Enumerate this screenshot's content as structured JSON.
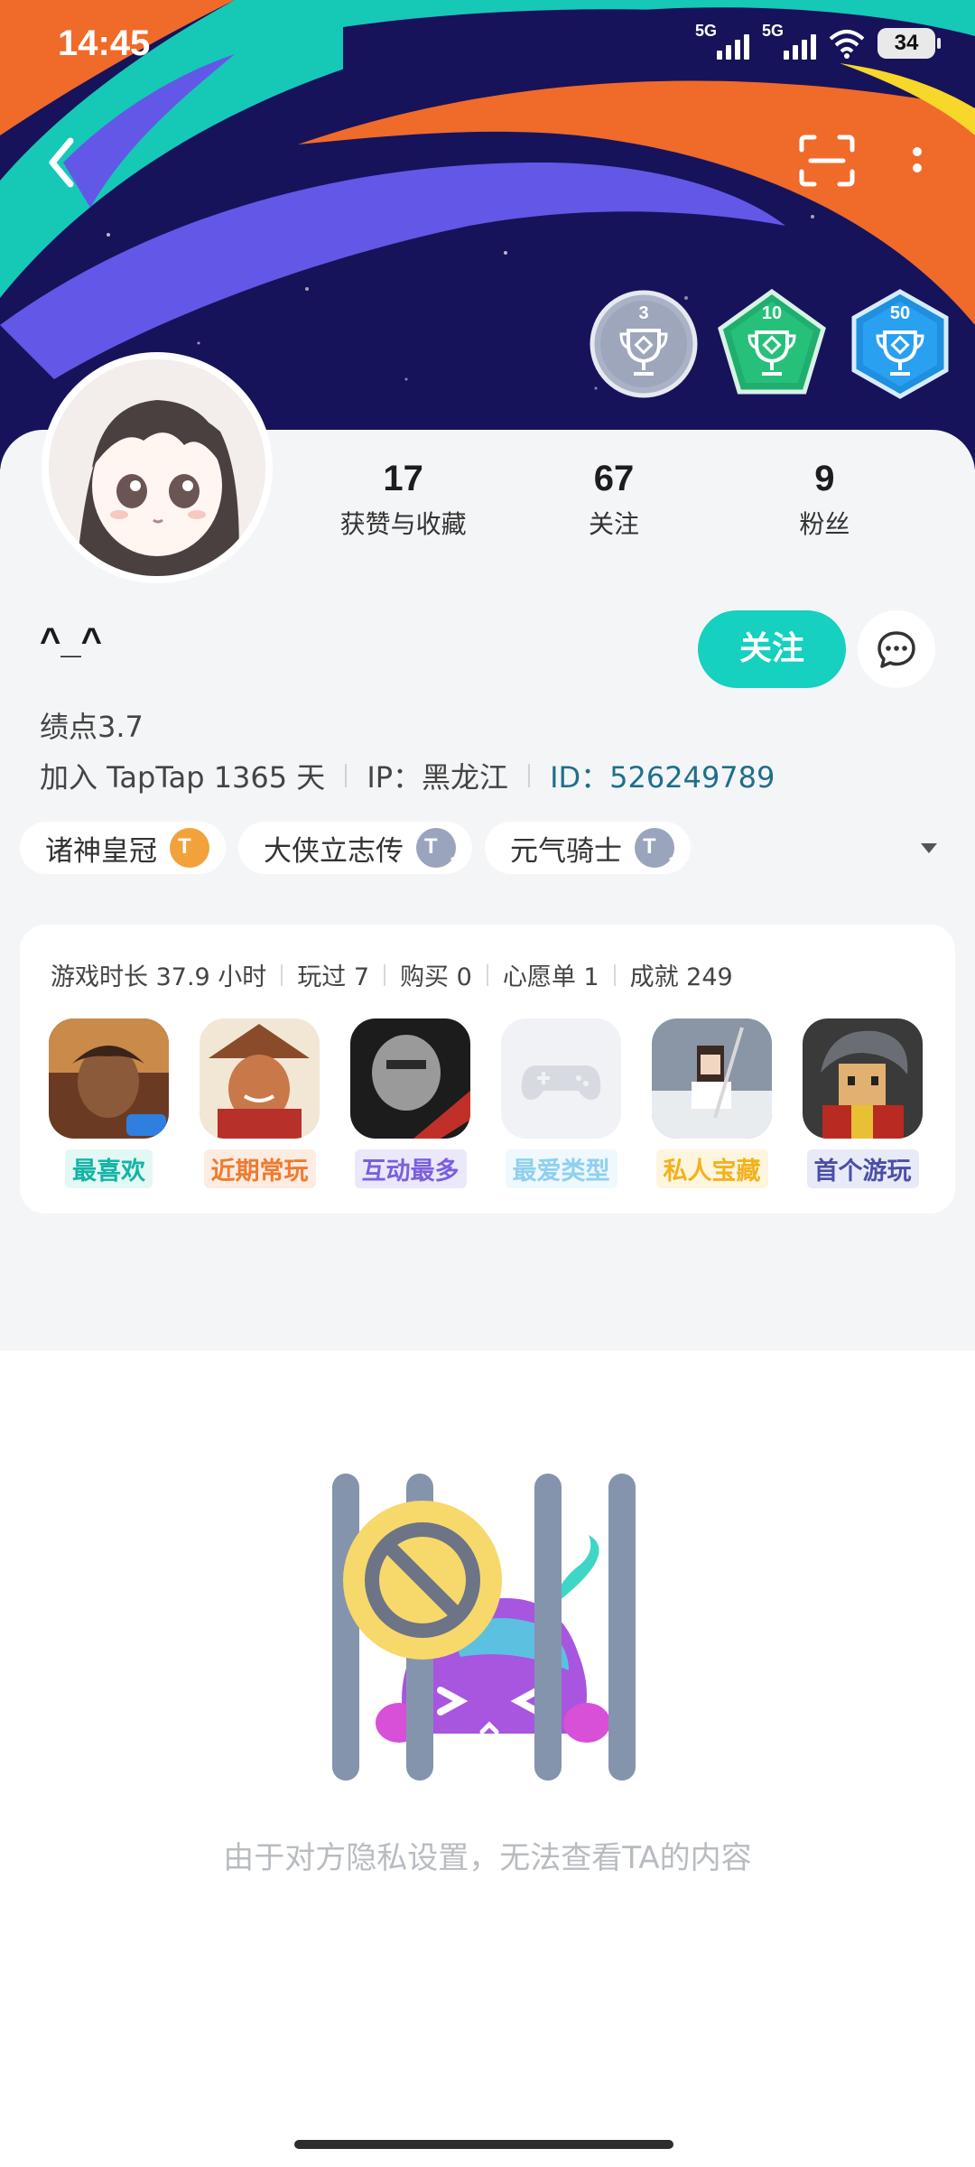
{
  "status_bar": {
    "time": "14:45",
    "signal1": "5G",
    "signal2": "5G",
    "battery": "34"
  },
  "badges": [
    {
      "number": "3",
      "color": "#9ea6bb"
    },
    {
      "number": "10",
      "color": "#27c07a"
    },
    {
      "number": "50",
      "color": "#2aa0f0"
    }
  ],
  "stats": [
    {
      "number": "17",
      "label": "获赞与收藏"
    },
    {
      "number": "67",
      "label": "关注"
    },
    {
      "number": "9",
      "label": "粉丝"
    }
  ],
  "profile": {
    "nickname": "^_^",
    "follow_label": "关注",
    "level": "绩点3.7",
    "joined": "加入 TapTap 1365 天",
    "ip": "IP：黑龙江",
    "id": "ID：526249789"
  },
  "tags": [
    {
      "name": "诸神皇冠",
      "level": "4",
      "color": "#f2a23a"
    },
    {
      "name": "大侠立志传",
      "level": "1",
      "color": "#9aa4bd"
    },
    {
      "name": "元气骑士",
      "level": "1",
      "color": "#9aa4bd"
    }
  ],
  "game_stats": [
    "游戏时长 37.9 小时",
    "玩过 7",
    "购买 0",
    "心愿单 1",
    "成就 249"
  ],
  "games": [
    {
      "label": "最喜欢",
      "label_color": "#12b5a6",
      "label_bg": "#e3f7f4"
    },
    {
      "label": "近期常玩",
      "label_color": "#f07a2e",
      "label_bg": "#fdece1"
    },
    {
      "label": "互动最多",
      "label_color": "#7b5fe0",
      "label_bg": "#ece8fb"
    },
    {
      "label": "最爱类型",
      "label_color": "#8fd0ee",
      "label_bg": "#eef8fd"
    },
    {
      "label": "私人宝藏",
      "label_color": "#f2b21c",
      "label_bg": "#fdf5de"
    },
    {
      "label": "首个游玩",
      "label_color": "#4b4fa8",
      "label_bg": "#e9eaf7"
    }
  ],
  "empty_message": "由于对方隐私设置，无法查看TA的内容"
}
